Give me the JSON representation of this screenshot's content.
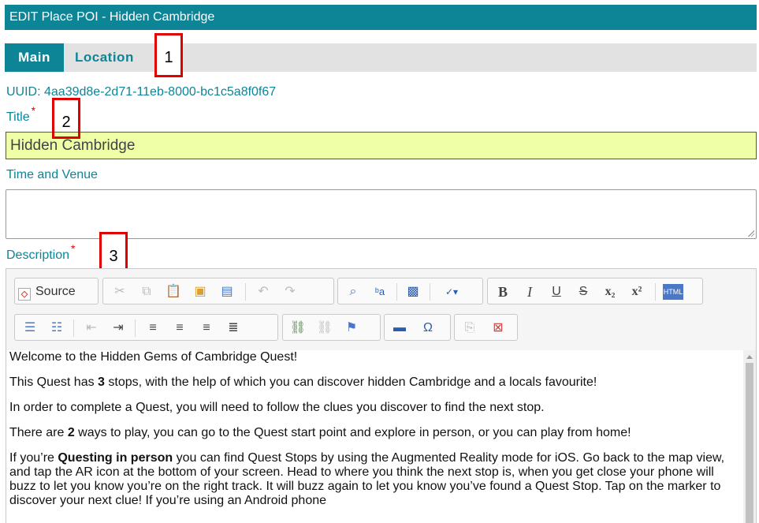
{
  "window": {
    "title": "EDIT Place POI - Hidden Cambridge"
  },
  "tabs": [
    {
      "label": "Main"
    },
    {
      "label": "Location"
    }
  ],
  "callouts": [
    "1",
    "2",
    "3"
  ],
  "uuid": "UUID: 4aa39d8e-2d71-11eb-8000-bc1c5a8f0f67",
  "fields": {
    "title": {
      "label": "Title",
      "required": "*",
      "value": "Hidden Cambridge"
    },
    "time_venue": {
      "label": "Time and Venue",
      "value": ""
    },
    "description": {
      "label": "Description",
      "required": "*"
    }
  },
  "editor": {
    "source_label": "Source",
    "toolbar_icons": [
      "source-icon",
      "cut-icon",
      "copy-icon",
      "paste-icon",
      "paste-text-icon",
      "paste-word-icon",
      "undo-icon",
      "redo-icon",
      "find-icon",
      "replace-icon",
      "select-all-icon",
      "spellcheck-icon",
      "bold-icon",
      "italic-icon",
      "underline-icon",
      "strike-icon",
      "subscript-icon",
      "superscript-icon",
      "html-icon",
      "numbered-list-icon",
      "bulleted-list-icon",
      "outdent-icon",
      "indent-icon",
      "align-left-icon",
      "align-center-icon",
      "align-right-icon",
      "justify-icon",
      "link-icon",
      "unlink-icon",
      "anchor-icon",
      "horizontal-rule-icon",
      "special-char-icon",
      "templates-icon",
      "remove-format-icon"
    ],
    "paragraphs": [
      {
        "text": "Welcome to the Hidden Gems of Cambridge Quest!"
      },
      {
        "pre": "This Quest has ",
        "bold": "3",
        "post": " stops, with the help of which you can discover hidden Cambridge and a locals favourite!"
      },
      {
        "text": "In order to complete a Quest, you will need to follow the clues you discover to find the next stop."
      },
      {
        "pre": "There are ",
        "bold": "2",
        "post": " ways to play, you can go to the Quest start point and explore in person, or you can play from home!"
      },
      {
        "pre": "If you’re ",
        "bold": "Questing in person",
        "post": " you can find Quest Stops by using the Augmented Reality mode for iOS. Go back to the map view, and tap the AR icon at the bottom of your screen. Head to where you think the next stop is, when you get close your phone will buzz to let you know you’re on the right track. It will buzz again to let you know you’ve found a Quest Stop. Tap on the marker to discover your next clue! If you’re using an Android phone"
      }
    ]
  }
}
